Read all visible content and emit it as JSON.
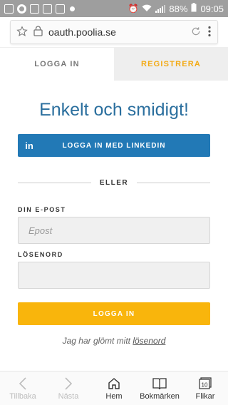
{
  "status_bar": {
    "battery_percent": "88%",
    "time": "09:05"
  },
  "browser": {
    "url": "oauth.poolia.se",
    "star_icon": "star-icon",
    "lock_icon": "lock-icon",
    "reload_icon": "reload-icon",
    "menu_icon": "kebab-menu-icon"
  },
  "tabs": {
    "login": "LOGGA IN",
    "register": "REGISTRERA"
  },
  "heading": "Enkelt och smidigt!",
  "linkedin_button": {
    "icon_text": "in",
    "label": "LOGGA IN MED LINKEDIN"
  },
  "divider_text": "ELLER",
  "form": {
    "email_label": "DIN E-POST",
    "email_placeholder": "Epost",
    "email_value": "",
    "password_label": "LÖSENORD",
    "password_placeholder": "",
    "password_value": "",
    "submit_label": "LOGGA IN"
  },
  "forgot": {
    "prefix": "Jag har glömt mitt",
    "link": "lösenord"
  },
  "bottom_nav": {
    "back": "Tillbaka",
    "forward": "Nästa",
    "home": "Hem",
    "bookmarks": "Bokmärken",
    "tabs": "Flikar",
    "tabs_count": "10"
  },
  "colors": {
    "accent_blue": "#2279b6",
    "heading_blue": "#2b6f9e",
    "accent_orange": "#f9b50c",
    "register_text": "#f3aa14"
  }
}
